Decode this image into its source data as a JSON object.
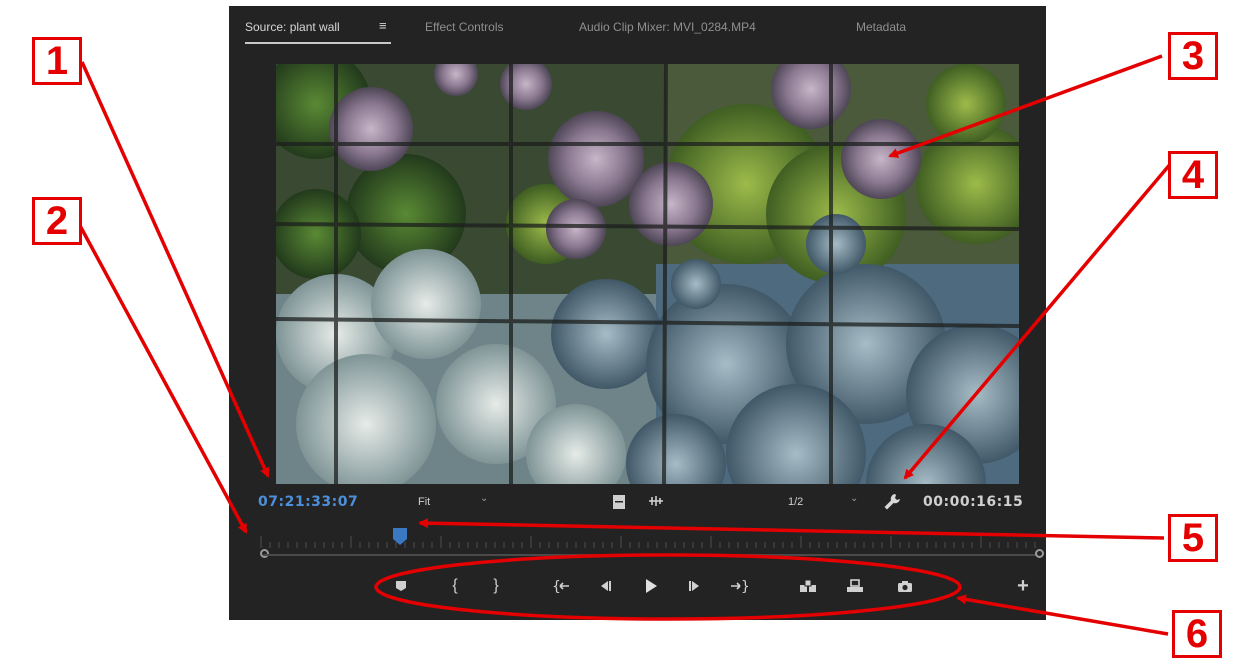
{
  "tabs": [
    {
      "label": "Source: plant wall",
      "active": true
    },
    {
      "label": "Effect Controls",
      "active": false
    },
    {
      "label": "Audio Clip Mixer: MVI_0284.MP4",
      "active": false
    },
    {
      "label": "Metadata",
      "active": false
    }
  ],
  "source_monitor": {
    "clip_name": "plant wall",
    "current_timecode": "07:21:33:07",
    "zoom_level": "Fit",
    "playback_resolution": "1/2",
    "duration_timecode": "00:00:16:15",
    "playhead_position": 0.18
  },
  "transport_buttons": [
    {
      "name": "add-marker-icon"
    },
    {
      "name": "mark-in-icon"
    },
    {
      "name": "mark-out-icon"
    },
    {
      "name": "go-to-in-icon"
    },
    {
      "name": "step-back-icon"
    },
    {
      "name": "play-icon"
    },
    {
      "name": "step-forward-icon"
    },
    {
      "name": "go-to-out-icon"
    },
    {
      "name": "insert-icon"
    },
    {
      "name": "overwrite-icon"
    },
    {
      "name": "export-frame-icon"
    },
    {
      "name": "button-editor-plus-icon"
    }
  ],
  "annotations": {
    "n1": "1",
    "n2": "2",
    "n3": "3",
    "n4": "4",
    "n5": "5",
    "n6": "6"
  },
  "colors": {
    "panel_bg": "#232323",
    "timecode_blue": "#4e8fd9",
    "playhead_blue": "#3a78c2",
    "annotation_red": "#e40000"
  }
}
